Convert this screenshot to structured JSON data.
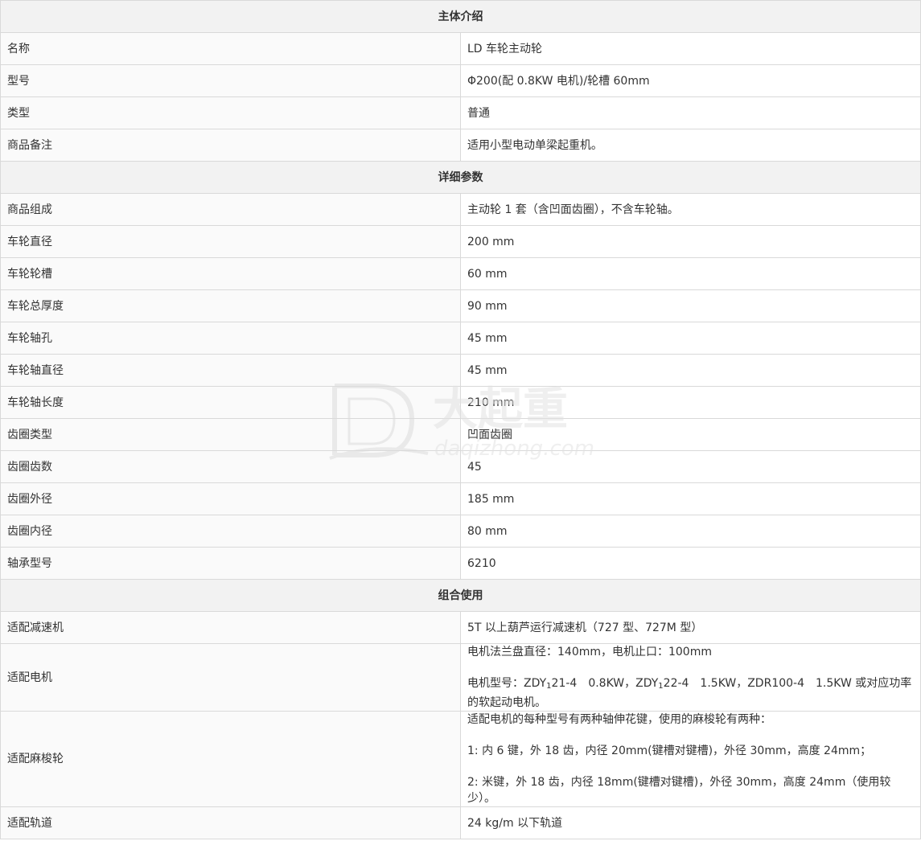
{
  "sections": {
    "main": {
      "title": "主体介绍",
      "rows": [
        {
          "label": "名称",
          "value": "LD 车轮主动轮"
        },
        {
          "label": "型号",
          "value": "Φ200(配 0.8KW 电机)/轮槽 60mm"
        },
        {
          "label": "类型",
          "value": "普通"
        },
        {
          "label": "商品备注",
          "value": "适用小型电动单梁起重机。"
        }
      ]
    },
    "detail": {
      "title": "详细参数",
      "rows": [
        {
          "label": "商品组成",
          "value": "主动轮 1 套（含凹面齿圈），不含车轮轴。"
        },
        {
          "label": "车轮直径",
          "value": "200 mm"
        },
        {
          "label": "车轮轮槽",
          "value": "60 mm"
        },
        {
          "label": "车轮总厚度",
          "value": "90 mm"
        },
        {
          "label": "车轮轴孔",
          "value": "45 mm"
        },
        {
          "label": "车轮轴直径",
          "value": "45 mm"
        },
        {
          "label": "车轮轴长度",
          "value": "210 mm"
        },
        {
          "label": "齿圈类型",
          "value": "凹面齿圈"
        },
        {
          "label": "齿圈齿数",
          "value": "45"
        },
        {
          "label": "齿圈外径",
          "value": "185 mm"
        },
        {
          "label": "齿圈内径",
          "value": "80 mm"
        },
        {
          "label": "轴承型号",
          "value": "6210"
        }
      ]
    },
    "combo": {
      "title": "组合使用",
      "reducer": {
        "label": "适配减速机",
        "value": "5T 以上葫芦运行减速机（727 型、727M 型）"
      },
      "motor": {
        "label": "适配电机",
        "line1": "电机法兰盘直径：140mm，电机止口：100mm",
        "line2_prefix": "电机型号：ZDY",
        "line2_sub1": "1",
        "line2_mid": "21-4　0.8KW，ZDY",
        "line2_sub2": "1",
        "line2_suffix": "22-4　1.5KW，ZDR100-4　1.5KW 或对应功率的软起动电机。"
      },
      "sprocket": {
        "label": "适配麻梭轮",
        "line1": "适配电机的每种型号有两种轴伸花键，使用的麻梭轮有两种：",
        "line2": "1:  内 6 键，外 18 齿，内径 20mm(键槽对键槽)，外径 30mm，高度 24mm；",
        "line3": "2:  米键，外 18 齿，内径 18mm(键槽对键槽)，外径 30mm，高度 24mm（使用较少）。"
      },
      "rail": {
        "label": "适配轨道",
        "value": "24 kg/m 以下轨道"
      }
    }
  },
  "watermark": {
    "logo_text": "大起重",
    "domain_text": "daqizhong.com",
    "color": "#dcdcdc"
  }
}
